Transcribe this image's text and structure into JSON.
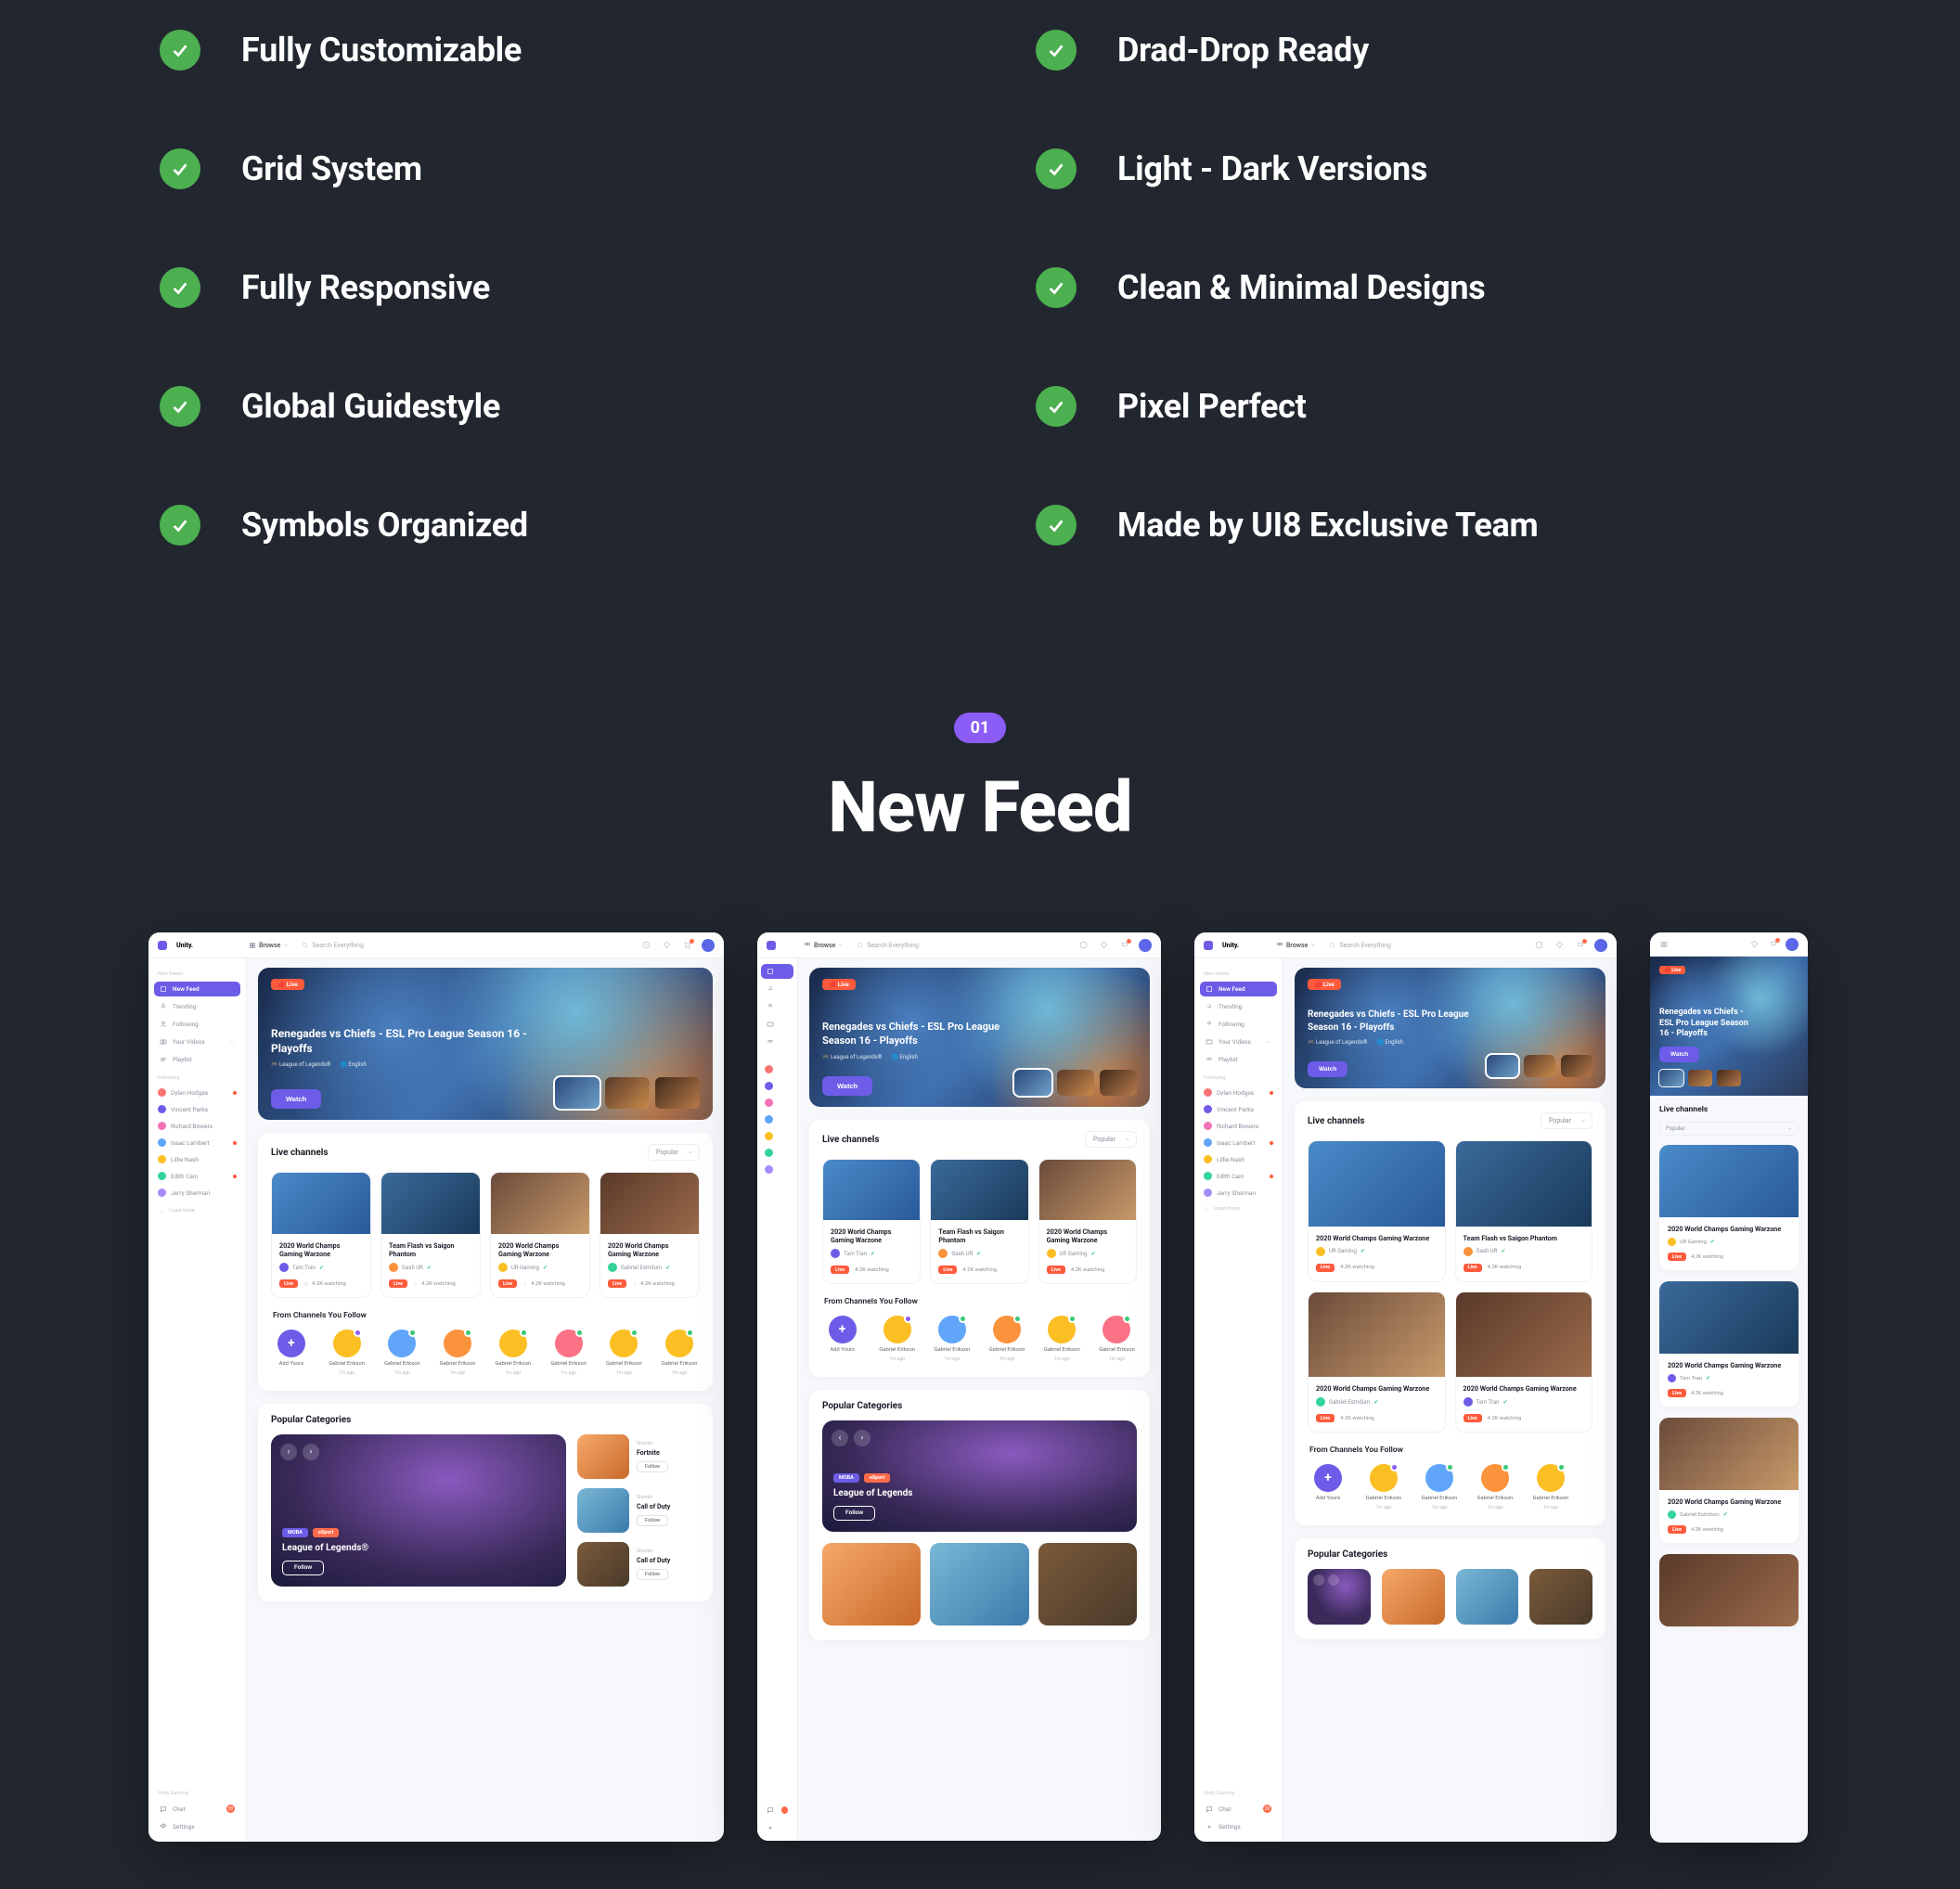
{
  "features_left": [
    "Fully Customizable",
    "Grid System",
    "Fully Responsive",
    "Global Guidestyle",
    "Symbols Organized"
  ],
  "features_right": [
    "Drad-Drop Ready",
    "Light - Dark Versions",
    "Clean & Minimal Designs",
    "Pixel Perfect",
    "Made by UI8 Exclusive Team"
  ],
  "section": {
    "number": "01",
    "title": "New Feed"
  },
  "app": {
    "logo_text": "Unity.",
    "browse": "Browse",
    "search_placeholder": "Search Everything",
    "nav_group_feed": "New Feeds",
    "nav": {
      "new_feed": "New Feed",
      "trending": "Trending",
      "following": "Following",
      "your_videos": "Your Videos",
      "playlist": "Playlist"
    },
    "group_following": "Following",
    "followers": [
      {
        "name": "Dylan Hodges",
        "color": "#f97373"
      },
      {
        "name": "Vincent Parks",
        "color": "#6c5ce7"
      },
      {
        "name": "Richard Bowers",
        "color": "#f472b6"
      },
      {
        "name": "Isaac Lambert",
        "color": "#60a5fa"
      },
      {
        "name": "Lillie Nash",
        "color": "#fbbf24"
      },
      {
        "name": "Edith Cain",
        "color": "#34d399"
      },
      {
        "name": "Jerry Sherman",
        "color": "#a78bfa"
      }
    ],
    "load_more": "Load more",
    "group_unity": "Unity Gaming",
    "chat": "Chat",
    "chat_count": "20",
    "settings": "Settings"
  },
  "hero": {
    "live": "🔴 Live",
    "title": "Renegades vs Chiefs - ESL Pro League Season 16 - Playoffs",
    "meta_game": "🎮 League of Legends®",
    "meta_lang": "🌐 English",
    "watch": "Watch"
  },
  "live": {
    "title": "Live channels",
    "select": "Popular",
    "cards": [
      {
        "t": "2020 World Champs Gaming Warzone",
        "by": "Tam Tran",
        "n": "4.2K watching"
      },
      {
        "t": "Team Flash vs Saigon Phantom",
        "by": "Gash UR",
        "n": "4.2K watching"
      },
      {
        "t": "2020 World Champs Gaming Warzone",
        "by": "UR Gaming",
        "n": "4.2K watching"
      },
      {
        "t": "2020 World Champs Gaming Warzone",
        "by": "Gabriel Estridum",
        "n": "4.2K watching"
      }
    ],
    "pill": "Live"
  },
  "follow": {
    "title": "From Channels You Follow",
    "add": "Add Yours",
    "items": [
      {
        "n": "Gabriel Erikson",
        "t": "1m ago"
      },
      {
        "n": "Gabriel Erikson",
        "t": "1m ago"
      },
      {
        "n": "Gabriel Erikson",
        "t": "1m ago"
      },
      {
        "n": "Gabriel Erikson",
        "t": "1m ago"
      },
      {
        "n": "Gabriel Erikson",
        "t": "1m ago"
      },
      {
        "n": "Gabriel Erikson",
        "t": "1m ago"
      },
      {
        "n": "Gabriel Erikson",
        "t": "1m ago"
      }
    ]
  },
  "categories": {
    "title": "Popular Categories",
    "big": {
      "name": "League of Legends®",
      "tag1": "MOBA",
      "tag2": "eSport",
      "follow": "Follow"
    },
    "items": [
      {
        "t": "Fortnite",
        "s": "Shooter",
        "f": "Follow"
      },
      {
        "t": "Call of Duty",
        "s": "Shooter",
        "f": "Follow"
      },
      {
        "t": "Call of Duty",
        "s": "Shooter",
        "f": "Follow"
      }
    ],
    "big2_name": "League of Legends"
  },
  "mobile_hero_title": "Renegades vs Chiefs - ESL Pro League Season 16 - Playoffs"
}
